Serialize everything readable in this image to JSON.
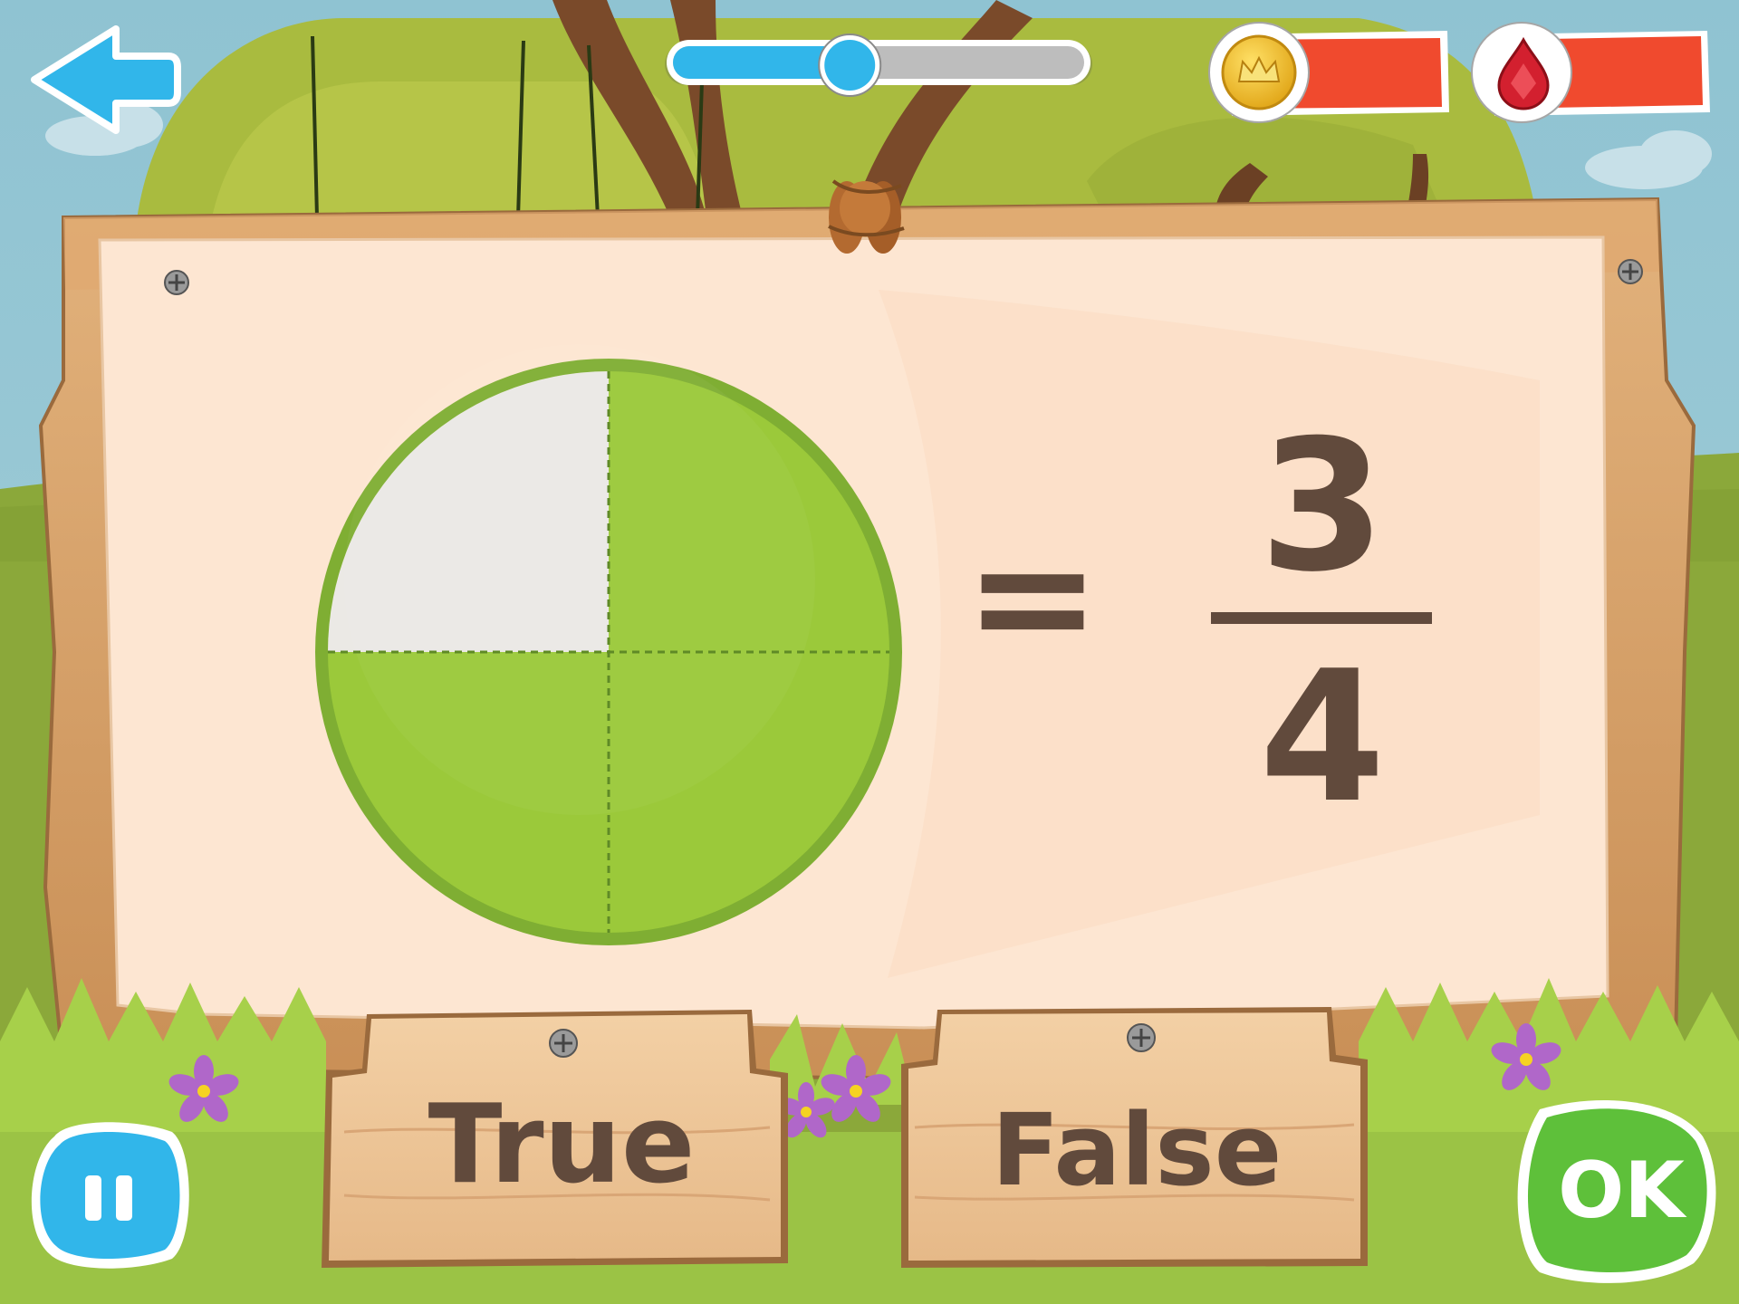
{
  "hud": {
    "back_icon": "back-arrow-icon",
    "progress_fraction": 0.43,
    "coin_icon": "crown-coin-icon",
    "gem_icon": "ruby-gem-icon",
    "pause_icon": "pause-icon"
  },
  "question": {
    "equals": "=",
    "numerator": "3",
    "denominator": "4",
    "pie_total_parts": 4,
    "pie_shaded_parts": 3
  },
  "answers": {
    "true_label": "True",
    "false_label": "False"
  },
  "ok_label": "OK",
  "colors": {
    "sky": "#8fc3d2",
    "foliage": "#a9bb3f",
    "ground": "#8ba83a",
    "board": "#fde6d2",
    "pie_green": "#9bc93a",
    "pie_empty": "#ebe9e5",
    "text_brown": "#614a3c",
    "hud_blue": "#31b6ea",
    "hud_red": "#f04a2e",
    "ok_green": "#5ec03a"
  }
}
